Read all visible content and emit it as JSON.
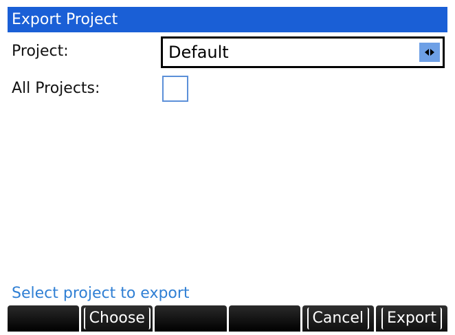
{
  "window": {
    "title": "Export Project"
  },
  "form": {
    "project_label": "Project:",
    "project_value": "Default",
    "all_projects_label": "All Projects:",
    "all_projects_checked": false
  },
  "status": {
    "message": "Select project to export"
  },
  "softkeys": [
    "",
    "Choose",
    "",
    "",
    "Cancel",
    "Export"
  ],
  "colors": {
    "titlebar": "#1a5fd6",
    "status_text": "#2f7fd4",
    "select_arrow_bg": "#6ea0e6",
    "checkbox_border": "#5b8fd8"
  }
}
